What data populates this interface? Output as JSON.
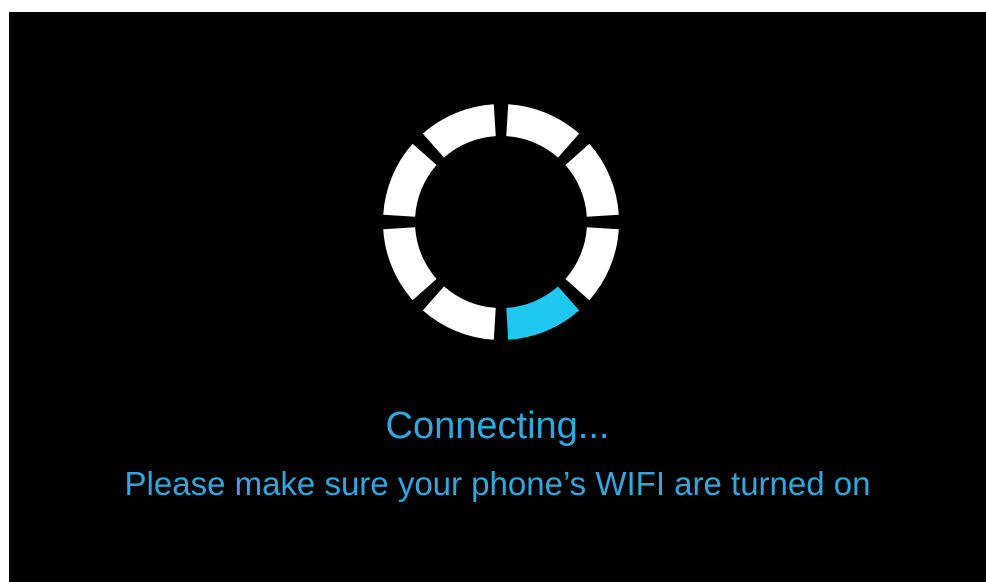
{
  "colors": {
    "background": "#000000",
    "spinner_idle": "#ffffff",
    "spinner_active": "#1ec8ee",
    "text": "#33a7dd"
  },
  "spinner": {
    "segment_count": 8,
    "active_segment_index": 3
  },
  "status": {
    "title": "Connecting...",
    "hint": "Please make sure your phone’s WIFI are turned on"
  }
}
